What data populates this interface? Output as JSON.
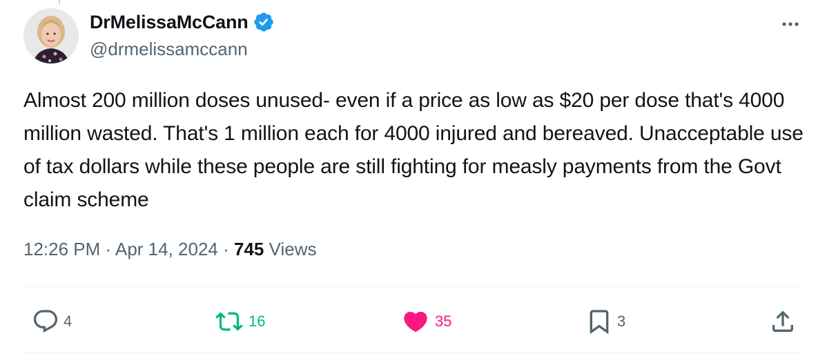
{
  "author": {
    "display_name": "DrMelissaMcCann",
    "handle": "@drmelissamccann",
    "verified_color": "#1d9bf0",
    "avatar_icon": "profile-photo"
  },
  "tweet": {
    "text": "Almost 200 million doses unused- even if a price as low as $20 per dose that's 4000 million wasted. That's 1 million each for 4000 injured and bereaved. Unacceptable use of tax dollars while these people are still fighting for measly payments from the Govt claim scheme",
    "time": "12:26 PM",
    "separator": "·",
    "date": "Apr 14, 2024",
    "views_count": "745",
    "views_label": "Views"
  },
  "actions": {
    "replies": "4",
    "retweets": "16",
    "likes": "35",
    "bookmarks": "3"
  },
  "colors": {
    "text_primary": "#0f1419",
    "text_secondary": "#536471",
    "retweet_active": "#00ba7c",
    "like_active": "#f91880",
    "divider": "#eff3f4"
  },
  "icons": {
    "more": "more-dots-icon",
    "reply": "reply-bubble-icon",
    "retweet": "retweet-arrows-icon",
    "like": "heart-filled-icon",
    "bookmark": "bookmark-icon",
    "share": "share-upload-icon"
  }
}
